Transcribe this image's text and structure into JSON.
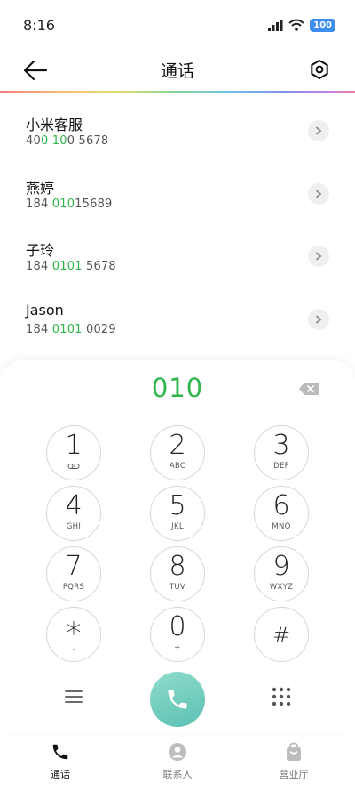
{
  "status_bar": {
    "time": "8:16",
    "battery": "100",
    "signal_icon": "signal-bars-icon",
    "wifi_icon": "wifi-icon"
  },
  "header": {
    "title": "通话",
    "back_icon": "arrow-left-icon",
    "settings_icon": "gear-hexagon-icon"
  },
  "contacts": [
    {
      "name": "小米客服",
      "number_parts": [
        "40",
        "0 10",
        "0 5678"
      ]
    },
    {
      "name": "燕婷",
      "number_parts": [
        "184 ",
        "010",
        "15689"
      ]
    },
    {
      "name": "子玲",
      "number_parts": [
        "184 ",
        "0101",
        " 5678"
      ]
    },
    {
      "name": "Jason",
      "number_parts": [
        "184 ",
        "0101",
        " 0029"
      ]
    }
  ],
  "dialpad": {
    "dialed_number": "010",
    "backspace_icon": "backspace-icon",
    "keys": [
      {
        "digit": "1",
        "sub": "",
        "sub_icon": "voicemail-icon"
      },
      {
        "digit": "2",
        "sub": "ABC"
      },
      {
        "digit": "3",
        "sub": "DEF"
      },
      {
        "digit": "4",
        "sub": "GHI"
      },
      {
        "digit": "5",
        "sub": "JKL"
      },
      {
        "digit": "6",
        "sub": "MNO"
      },
      {
        "digit": "7",
        "sub": "PQRS"
      },
      {
        "digit": "8",
        "sub": "TUV"
      },
      {
        "digit": "9",
        "sub": "WXYZ"
      },
      {
        "digit": "*",
        "sub": ","
      },
      {
        "digit": "0",
        "sub": "+"
      },
      {
        "digit": "#",
        "sub": ""
      }
    ],
    "menu_icon": "hamburger-menu-icon",
    "call_icon": "phone-icon",
    "keypad_toggle_icon": "keypad-grid-icon"
  },
  "bottom_nav": [
    {
      "label": "通话",
      "icon": "phone-icon",
      "active": true
    },
    {
      "label": "联系人",
      "icon": "contact-person-icon",
      "active": false
    },
    {
      "label": "营业厅",
      "icon": "shopping-bag-icon",
      "active": false
    }
  ],
  "colors": {
    "highlight": "#2fb64a",
    "call_button": "#6ccabd",
    "battery": "#3d8ef0"
  }
}
